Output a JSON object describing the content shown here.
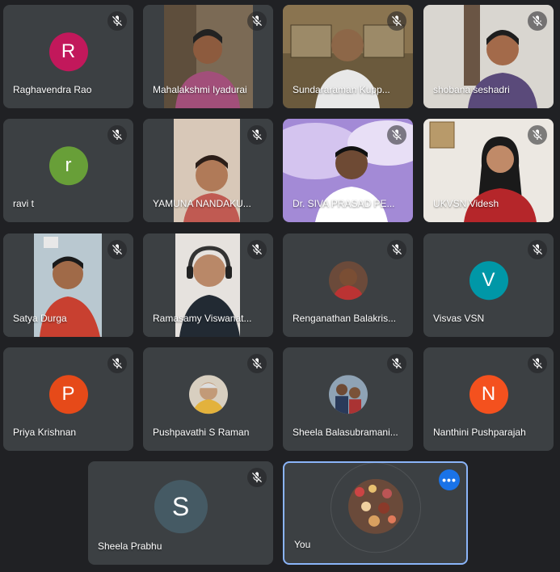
{
  "participants": [
    {
      "name": "Raghavendra Rao",
      "initial": "R",
      "color": "#c2185b"
    },
    {
      "name": "Mahalakshmi Iyadurai"
    },
    {
      "name": "Sundararaman Kupp..."
    },
    {
      "name": "shobana seshadri"
    },
    {
      "name": "ravi t",
      "initial": "r",
      "color": "#689f38"
    },
    {
      "name": "YAMUNA NANDAKU..."
    },
    {
      "name": "Dr. SIVA PRASAD PE..."
    },
    {
      "name": "UKVSN Videsh"
    },
    {
      "name": "Satya Durga"
    },
    {
      "name": "Ramasamy Viswanat..."
    },
    {
      "name": "Renganathan Balakris..."
    },
    {
      "name": "Visvas VSN",
      "initial": "V",
      "color": "#0097a7"
    },
    {
      "name": "Priya Krishnan",
      "initial": "P",
      "color": "#e64a19"
    },
    {
      "name": "Pushpavathi S Raman"
    },
    {
      "name": "Sheela Balasubramani..."
    },
    {
      "name": "Nanthini Pushparajah",
      "initial": "N",
      "color": "#f4511e"
    },
    {
      "name": "Sheela Prabhu",
      "initial": "S",
      "color": "#455a64"
    },
    {
      "name": "You"
    }
  ],
  "icons": {
    "mute": "mic-off-icon",
    "more": "more-options-icon"
  }
}
